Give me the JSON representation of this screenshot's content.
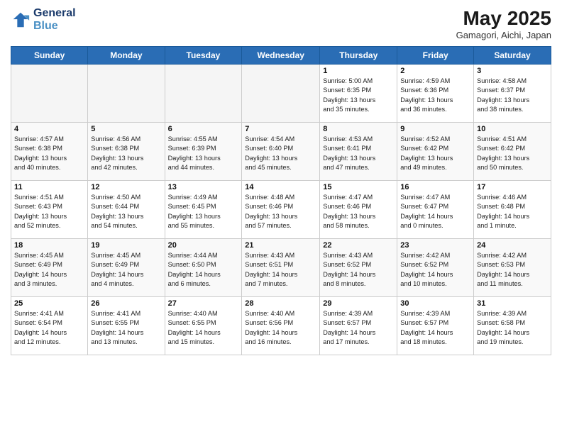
{
  "header": {
    "logo_line1": "General",
    "logo_line2": "Blue",
    "month": "May 2025",
    "location": "Gamagori, Aichi, Japan"
  },
  "weekdays": [
    "Sunday",
    "Monday",
    "Tuesday",
    "Wednesday",
    "Thursday",
    "Friday",
    "Saturday"
  ],
  "weeks": [
    [
      {
        "day": "",
        "info": ""
      },
      {
        "day": "",
        "info": ""
      },
      {
        "day": "",
        "info": ""
      },
      {
        "day": "",
        "info": ""
      },
      {
        "day": "1",
        "info": "Sunrise: 5:00 AM\nSunset: 6:35 PM\nDaylight: 13 hours\nand 35 minutes."
      },
      {
        "day": "2",
        "info": "Sunrise: 4:59 AM\nSunset: 6:36 PM\nDaylight: 13 hours\nand 36 minutes."
      },
      {
        "day": "3",
        "info": "Sunrise: 4:58 AM\nSunset: 6:37 PM\nDaylight: 13 hours\nand 38 minutes."
      }
    ],
    [
      {
        "day": "4",
        "info": "Sunrise: 4:57 AM\nSunset: 6:38 PM\nDaylight: 13 hours\nand 40 minutes."
      },
      {
        "day": "5",
        "info": "Sunrise: 4:56 AM\nSunset: 6:38 PM\nDaylight: 13 hours\nand 42 minutes."
      },
      {
        "day": "6",
        "info": "Sunrise: 4:55 AM\nSunset: 6:39 PM\nDaylight: 13 hours\nand 44 minutes."
      },
      {
        "day": "7",
        "info": "Sunrise: 4:54 AM\nSunset: 6:40 PM\nDaylight: 13 hours\nand 45 minutes."
      },
      {
        "day": "8",
        "info": "Sunrise: 4:53 AM\nSunset: 6:41 PM\nDaylight: 13 hours\nand 47 minutes."
      },
      {
        "day": "9",
        "info": "Sunrise: 4:52 AM\nSunset: 6:42 PM\nDaylight: 13 hours\nand 49 minutes."
      },
      {
        "day": "10",
        "info": "Sunrise: 4:51 AM\nSunset: 6:42 PM\nDaylight: 13 hours\nand 50 minutes."
      }
    ],
    [
      {
        "day": "11",
        "info": "Sunrise: 4:51 AM\nSunset: 6:43 PM\nDaylight: 13 hours\nand 52 minutes."
      },
      {
        "day": "12",
        "info": "Sunrise: 4:50 AM\nSunset: 6:44 PM\nDaylight: 13 hours\nand 54 minutes."
      },
      {
        "day": "13",
        "info": "Sunrise: 4:49 AM\nSunset: 6:45 PM\nDaylight: 13 hours\nand 55 minutes."
      },
      {
        "day": "14",
        "info": "Sunrise: 4:48 AM\nSunset: 6:46 PM\nDaylight: 13 hours\nand 57 minutes."
      },
      {
        "day": "15",
        "info": "Sunrise: 4:47 AM\nSunset: 6:46 PM\nDaylight: 13 hours\nand 58 minutes."
      },
      {
        "day": "16",
        "info": "Sunrise: 4:47 AM\nSunset: 6:47 PM\nDaylight: 14 hours\nand 0 minutes."
      },
      {
        "day": "17",
        "info": "Sunrise: 4:46 AM\nSunset: 6:48 PM\nDaylight: 14 hours\nand 1 minute."
      }
    ],
    [
      {
        "day": "18",
        "info": "Sunrise: 4:45 AM\nSunset: 6:49 PM\nDaylight: 14 hours\nand 3 minutes."
      },
      {
        "day": "19",
        "info": "Sunrise: 4:45 AM\nSunset: 6:49 PM\nDaylight: 14 hours\nand 4 minutes."
      },
      {
        "day": "20",
        "info": "Sunrise: 4:44 AM\nSunset: 6:50 PM\nDaylight: 14 hours\nand 6 minutes."
      },
      {
        "day": "21",
        "info": "Sunrise: 4:43 AM\nSunset: 6:51 PM\nDaylight: 14 hours\nand 7 minutes."
      },
      {
        "day": "22",
        "info": "Sunrise: 4:43 AM\nSunset: 6:52 PM\nDaylight: 14 hours\nand 8 minutes."
      },
      {
        "day": "23",
        "info": "Sunrise: 4:42 AM\nSunset: 6:52 PM\nDaylight: 14 hours\nand 10 minutes."
      },
      {
        "day": "24",
        "info": "Sunrise: 4:42 AM\nSunset: 6:53 PM\nDaylight: 14 hours\nand 11 minutes."
      }
    ],
    [
      {
        "day": "25",
        "info": "Sunrise: 4:41 AM\nSunset: 6:54 PM\nDaylight: 14 hours\nand 12 minutes."
      },
      {
        "day": "26",
        "info": "Sunrise: 4:41 AM\nSunset: 6:55 PM\nDaylight: 14 hours\nand 13 minutes."
      },
      {
        "day": "27",
        "info": "Sunrise: 4:40 AM\nSunset: 6:55 PM\nDaylight: 14 hours\nand 15 minutes."
      },
      {
        "day": "28",
        "info": "Sunrise: 4:40 AM\nSunset: 6:56 PM\nDaylight: 14 hours\nand 16 minutes."
      },
      {
        "day": "29",
        "info": "Sunrise: 4:39 AM\nSunset: 6:57 PM\nDaylight: 14 hours\nand 17 minutes."
      },
      {
        "day": "30",
        "info": "Sunrise: 4:39 AM\nSunset: 6:57 PM\nDaylight: 14 hours\nand 18 minutes."
      },
      {
        "day": "31",
        "info": "Sunrise: 4:39 AM\nSunset: 6:58 PM\nDaylight: 14 hours\nand 19 minutes."
      }
    ]
  ]
}
